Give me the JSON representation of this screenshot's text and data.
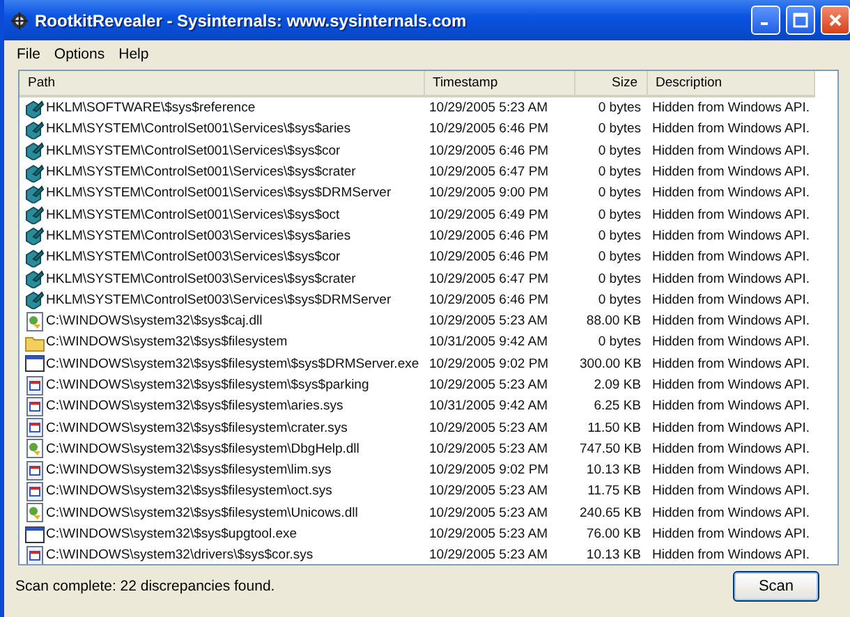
{
  "window": {
    "title": "RootkitRevealer - Sysinternals: www.sysinternals.com"
  },
  "menu": [
    "File",
    "Options",
    "Help"
  ],
  "table": {
    "columns": [
      "Path",
      "Timestamp",
      "Size",
      "Description"
    ],
    "rows": [
      {
        "kind": "registry",
        "path": "HKLM\\SOFTWARE\\$sys$reference",
        "timestamp": "10/29/2005 5:23 AM",
        "size": "0 bytes",
        "description": "Hidden from Windows API."
      },
      {
        "kind": "registry",
        "path": "HKLM\\SYSTEM\\ControlSet001\\Services\\$sys$aries",
        "timestamp": "10/29/2005 6:46 PM",
        "size": "0 bytes",
        "description": "Hidden from Windows API."
      },
      {
        "kind": "registry",
        "path": "HKLM\\SYSTEM\\ControlSet001\\Services\\$sys$cor",
        "timestamp": "10/29/2005 6:46 PM",
        "size": "0 bytes",
        "description": "Hidden from Windows API."
      },
      {
        "kind": "registry",
        "path": "HKLM\\SYSTEM\\ControlSet001\\Services\\$sys$crater",
        "timestamp": "10/29/2005 6:47 PM",
        "size": "0 bytes",
        "description": "Hidden from Windows API."
      },
      {
        "kind": "registry",
        "path": "HKLM\\SYSTEM\\ControlSet001\\Services\\$sys$DRMServer",
        "timestamp": "10/29/2005 9:00 PM",
        "size": "0 bytes",
        "description": "Hidden from Windows API."
      },
      {
        "kind": "registry",
        "path": "HKLM\\SYSTEM\\ControlSet001\\Services\\$sys$oct",
        "timestamp": "10/29/2005 6:49 PM",
        "size": "0 bytes",
        "description": "Hidden from Windows API."
      },
      {
        "kind": "registry",
        "path": "HKLM\\SYSTEM\\ControlSet003\\Services\\$sys$aries",
        "timestamp": "10/29/2005 6:46 PM",
        "size": "0 bytes",
        "description": "Hidden from Windows API."
      },
      {
        "kind": "registry",
        "path": "HKLM\\SYSTEM\\ControlSet003\\Services\\$sys$cor",
        "timestamp": "10/29/2005 6:46 PM",
        "size": "0 bytes",
        "description": "Hidden from Windows API."
      },
      {
        "kind": "registry",
        "path": "HKLM\\SYSTEM\\ControlSet003\\Services\\$sys$crater",
        "timestamp": "10/29/2005 6:47 PM",
        "size": "0 bytes",
        "description": "Hidden from Windows API."
      },
      {
        "kind": "registry",
        "path": "HKLM\\SYSTEM\\ControlSet003\\Services\\$sys$DRMServer",
        "timestamp": "10/29/2005 6:46 PM",
        "size": "0 bytes",
        "description": "Hidden from Windows API."
      },
      {
        "kind": "dll",
        "path": "C:\\WINDOWS\\system32\\$sys$caj.dll",
        "timestamp": "10/29/2005 5:23 AM",
        "size": "88.00 KB",
        "description": "Hidden from Windows API."
      },
      {
        "kind": "folder",
        "path": "C:\\WINDOWS\\system32\\$sys$filesystem",
        "timestamp": "10/31/2005 9:42 AM",
        "size": "0 bytes",
        "description": "Hidden from Windows API."
      },
      {
        "kind": "exe",
        "path": "C:\\WINDOWS\\system32\\$sys$filesystem\\$sys$DRMServer.exe",
        "timestamp": "10/29/2005 9:02 PM",
        "size": "300.00 KB",
        "description": "Hidden from Windows API."
      },
      {
        "kind": "sys",
        "path": "C:\\WINDOWS\\system32\\$sys$filesystem\\$sys$parking",
        "timestamp": "10/29/2005 5:23 AM",
        "size": "2.09 KB",
        "description": "Hidden from Windows API."
      },
      {
        "kind": "sys",
        "path": "C:\\WINDOWS\\system32\\$sys$filesystem\\aries.sys",
        "timestamp": "10/31/2005 9:42 AM",
        "size": "6.25 KB",
        "description": "Hidden from Windows API."
      },
      {
        "kind": "sys",
        "path": "C:\\WINDOWS\\system32\\$sys$filesystem\\crater.sys",
        "timestamp": "10/29/2005 5:23 AM",
        "size": "11.50 KB",
        "description": "Hidden from Windows API."
      },
      {
        "kind": "dll",
        "path": "C:\\WINDOWS\\system32\\$sys$filesystem\\DbgHelp.dll",
        "timestamp": "10/29/2005 5:23 AM",
        "size": "747.50 KB",
        "description": "Hidden from Windows API."
      },
      {
        "kind": "sys",
        "path": "C:\\WINDOWS\\system32\\$sys$filesystem\\lim.sys",
        "timestamp": "10/29/2005 9:02 PM",
        "size": "10.13 KB",
        "description": "Hidden from Windows API."
      },
      {
        "kind": "sys",
        "path": "C:\\WINDOWS\\system32\\$sys$filesystem\\oct.sys",
        "timestamp": "10/29/2005 5:23 AM",
        "size": "11.75 KB",
        "description": "Hidden from Windows API."
      },
      {
        "kind": "dll",
        "path": "C:\\WINDOWS\\system32\\$sys$filesystem\\Unicows.dll",
        "timestamp": "10/29/2005 5:23 AM",
        "size": "240.65 KB",
        "description": "Hidden from Windows API."
      },
      {
        "kind": "exe",
        "path": "C:\\WINDOWS\\system32\\$sys$upgtool.exe",
        "timestamp": "10/29/2005 5:23 AM",
        "size": "76.00 KB",
        "description": "Hidden from Windows API."
      },
      {
        "kind": "sys",
        "path": "C:\\WINDOWS\\system32\\drivers\\$sys$cor.sys",
        "timestamp": "10/29/2005 5:23 AM",
        "size": "10.13 KB",
        "description": "Hidden from Windows API."
      }
    ]
  },
  "status_bar": "Scan complete: 22 discrepancies found.",
  "buttons": [
    "Scan"
  ]
}
